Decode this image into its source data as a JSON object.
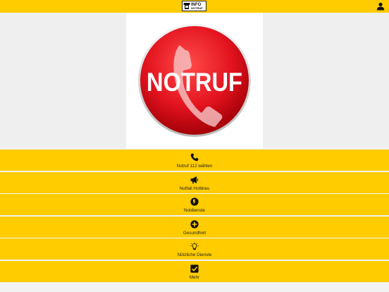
{
  "header": {
    "logo_main": "INFO",
    "logo_sub": "NOTRUF",
    "logo_icon": "phone-logo-icon",
    "account_icon": "user-icon",
    "bar_color": "#ffcc00"
  },
  "hero": {
    "button_text": "NOTRUF",
    "button_color": "#e3141f"
  },
  "menu": {
    "items": [
      {
        "label": "Notruf 112 wählen",
        "icon": "phone-icon"
      },
      {
        "label": "Notfall Hotlines",
        "icon": "megaphone-icon"
      },
      {
        "label": "Notdienste",
        "icon": "emergency-services-icon"
      },
      {
        "label": "Gesundheit",
        "icon": "plus-circle-icon"
      },
      {
        "label": "Nützliche Dienste",
        "icon": "lightbulb-icon"
      },
      {
        "label": "Mehr",
        "icon": "checkbox-icon"
      }
    ]
  }
}
